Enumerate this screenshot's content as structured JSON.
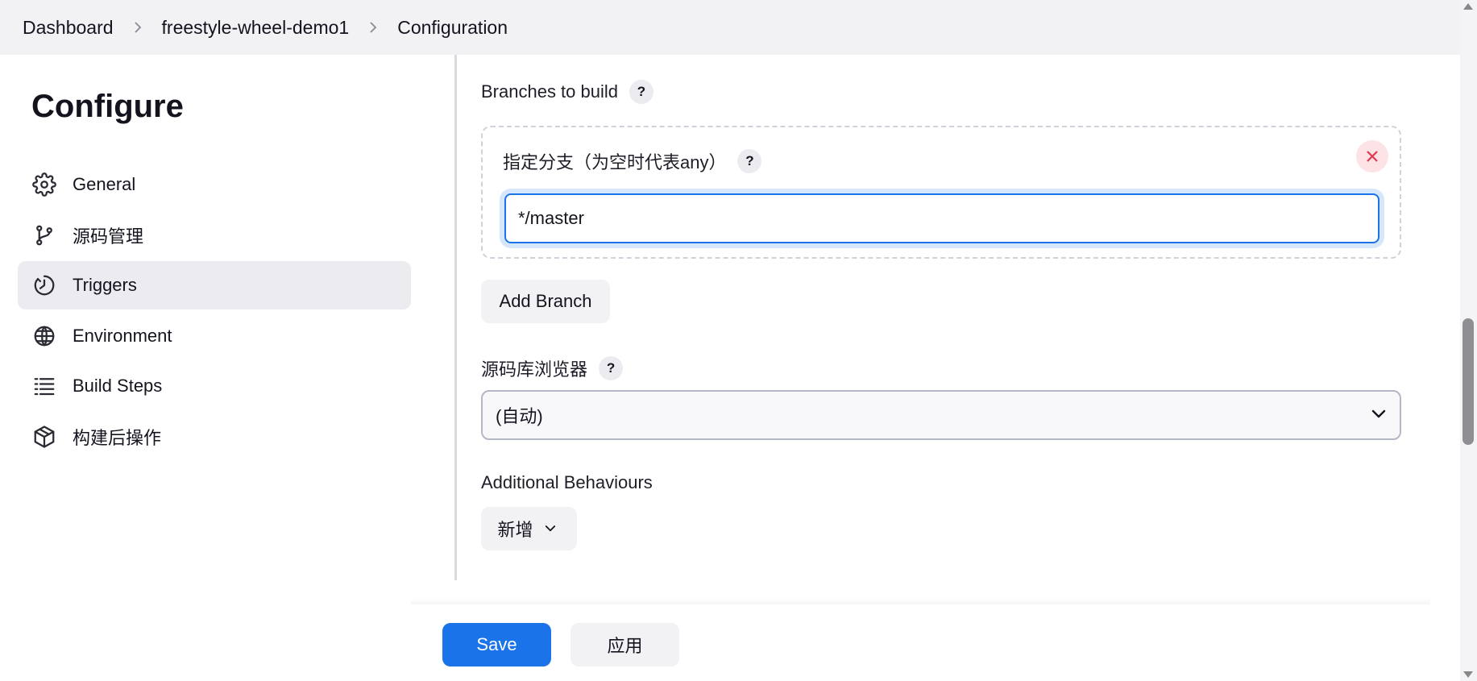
{
  "breadcrumb": {
    "items": [
      "Dashboard",
      "freestyle-wheel-demo1",
      "Configuration"
    ]
  },
  "sidebar": {
    "title": "Configure",
    "items": [
      {
        "label": "General",
        "icon": "gear-icon",
        "active": false
      },
      {
        "label": "源码管理",
        "icon": "git-branch-icon",
        "active": false
      },
      {
        "label": "Triggers",
        "icon": "clock-icon",
        "active": true
      },
      {
        "label": "Environment",
        "icon": "globe-icon",
        "active": false
      },
      {
        "label": "Build Steps",
        "icon": "list-icon",
        "active": false
      },
      {
        "label": "构建后操作",
        "icon": "package-icon",
        "active": false
      }
    ]
  },
  "main": {
    "branches_label": "Branches to build",
    "branch_specifier_label": "指定分支（为空时代表any）",
    "branch_specifier_value": "*/master",
    "add_branch_label": "Add Branch",
    "repo_browser_label": "源码库浏览器",
    "repo_browser_value": "(自动)",
    "additional_behaviours_label": "Additional Behaviours",
    "add_new_label": "新增",
    "help_glyph": "?"
  },
  "footer": {
    "save_label": "Save",
    "apply_label": "应用"
  },
  "colors": {
    "accent": "#1a73e8",
    "danger": "#e2384d",
    "active_nav_bg": "#ebebf0"
  }
}
